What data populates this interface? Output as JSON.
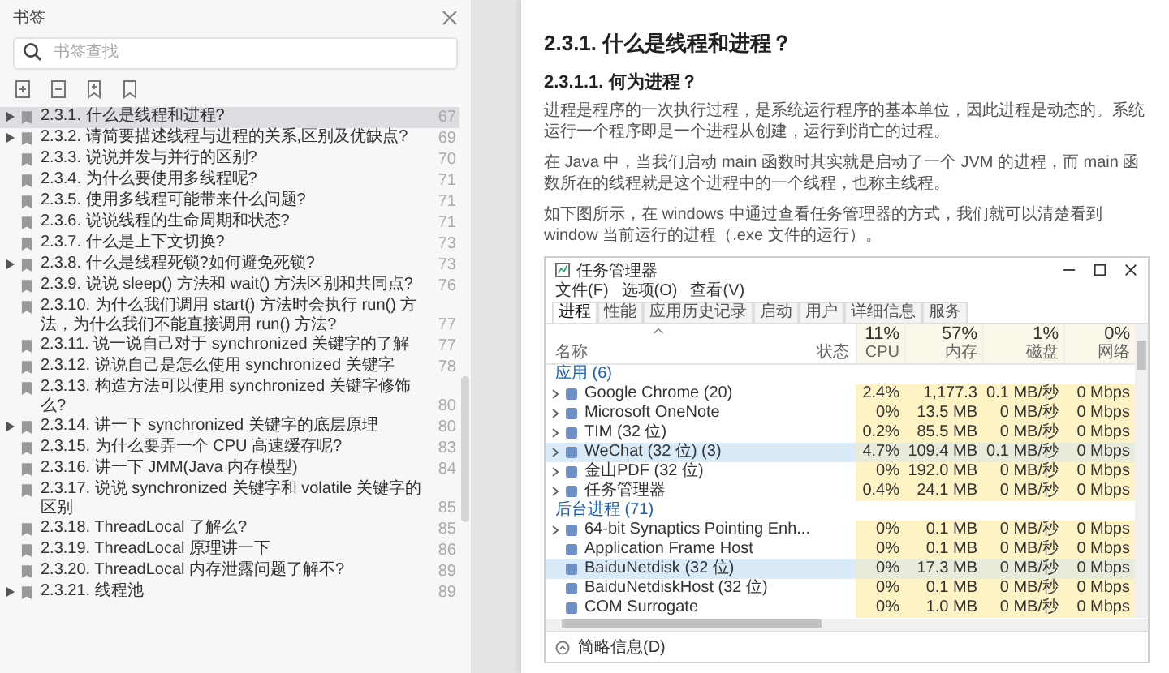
{
  "sidebar": {
    "title": "书签",
    "search": {
      "placeholder": "书签查找"
    },
    "bookmarks": [
      {
        "label": "2.3.1. 什么是线程和进程?",
        "page": "67",
        "has_children": true,
        "selected": true
      },
      {
        "label": "2.3.2. 请简要描述线程与进程的关系,区别及优缺点?",
        "page": "69",
        "has_children": true,
        "selected": false
      },
      {
        "label": "2.3.3. 说说并发与并行的区别?",
        "page": "70",
        "has_children": false,
        "selected": false
      },
      {
        "label": "2.3.4. 为什么要使用多线程呢?",
        "page": "71",
        "has_children": false,
        "selected": false
      },
      {
        "label": "2.3.5. 使用多线程可能带来什么问题?",
        "page": "71",
        "has_children": false,
        "selected": false
      },
      {
        "label": "2.3.6. 说说线程的生命周期和状态?",
        "page": "71",
        "has_children": false,
        "selected": false
      },
      {
        "label": "2.3.7. 什么是上下文切换?",
        "page": "73",
        "has_children": false,
        "selected": false
      },
      {
        "label": "2.3.8. 什么是线程死锁?如何避免死锁?",
        "page": "73",
        "has_children": true,
        "selected": false
      },
      {
        "label": "2.3.9. 说说 sleep() 方法和 wait() 方法区别和共同点?",
        "page": "76",
        "has_children": false,
        "selected": false
      },
      {
        "label": "2.3.10. 为什么我们调用 start() 方法时会执行 run() 方法，为什么我们不能直接调用 run() 方法?",
        "page": "77",
        "has_children": false,
        "selected": false
      },
      {
        "label": "2.3.11. 说一说自己对于 synchronized 关键字的了解",
        "page": "77",
        "has_children": false,
        "selected": false
      },
      {
        "label": "2.3.12. 说说自己是怎么使用 synchronized 关键字",
        "page": "78",
        "has_children": false,
        "selected": false
      },
      {
        "label": "2.3.13. 构造方法可以使用 synchronized 关键字修饰么?",
        "page": "80",
        "has_children": false,
        "selected": false
      },
      {
        "label": "2.3.14. 讲一下 synchronized 关键字的底层原理",
        "page": "80",
        "has_children": true,
        "selected": false
      },
      {
        "label": "2.3.15. 为什么要弄一个 CPU 高速缓存呢?",
        "page": "83",
        "has_children": false,
        "selected": false
      },
      {
        "label": "2.3.16. 讲一下 JMM(Java 内存模型)",
        "page": "84",
        "has_children": false,
        "selected": false
      },
      {
        "label": "2.3.17. 说说 synchronized 关键字和 volatile 关键字的区别",
        "page": "85",
        "has_children": false,
        "selected": false
      },
      {
        "label": "2.3.18. ThreadLocal 了解么?",
        "page": "85",
        "has_children": false,
        "selected": false
      },
      {
        "label": "2.3.19. ThreadLocal 原理讲一下",
        "page": "86",
        "has_children": false,
        "selected": false
      },
      {
        "label": "2.3.20. ThreadLocal 内存泄露问题了解不?",
        "page": "89",
        "has_children": false,
        "selected": false
      },
      {
        "label": "2.3.21. 线程池",
        "page": "89",
        "has_children": true,
        "selected": false
      }
    ]
  },
  "document": {
    "heading": "2.3.1. 什么是线程和进程？",
    "subheading": "2.3.1.1. 何为进程？",
    "paragraphs": [
      "进程是程序的一次执行过程，是系统运行程序的基本单位，因此进程是动态的。系统运行一个程序即是一个进程从创建，运行到消亡的过程。",
      "在 Java 中，当我们启动 main 函数时其实就是启动了一个 JVM 的进程，而 main 函数所在的线程就是这个进程中的一个线程，也称主线程。",
      "如下图所示，在 windows 中通过查看任务管理器的方式，我们就可以清楚看到 window 当前运行的进程（.exe 文件的运行）。"
    ],
    "task_manager": {
      "title": "任务管理器",
      "menu": [
        "文件(F)",
        "选项(O)",
        "查看(V)"
      ],
      "tabs": [
        {
          "label": "进程",
          "selected": true
        },
        {
          "label": "性能",
          "selected": false
        },
        {
          "label": "应用历史记录",
          "selected": false
        },
        {
          "label": "启动",
          "selected": false
        },
        {
          "label": "用户",
          "selected": false
        },
        {
          "label": "详细信息",
          "selected": false
        },
        {
          "label": "服务",
          "selected": false
        }
      ],
      "columns": [
        {
          "label": "名称"
        },
        {
          "label": "状态"
        },
        {
          "percent": "11%",
          "label": "CPU"
        },
        {
          "percent": "57%",
          "label": "内存"
        },
        {
          "percent": "1%",
          "label": "磁盘"
        },
        {
          "percent": "0%",
          "label": "网络"
        }
      ],
      "groups": [
        {
          "label": "应用 (6)",
          "rows": [
            {
              "name": "Google Chrome (20)",
              "cpu": "2.4%",
              "memory": "1,177.3",
              "disk": "0.1 MB/秒",
              "network": "0 Mbps",
              "expandable": true,
              "selected": false
            },
            {
              "name": "Microsoft OneNote",
              "cpu": "0%",
              "memory": "13.5 MB",
              "disk": "0 MB/秒",
              "network": "0 Mbps",
              "expandable": true,
              "selected": false
            },
            {
              "name": "TIM (32 位)",
              "cpu": "0.2%",
              "memory": "85.5 MB",
              "disk": "0 MB/秒",
              "network": "0 Mbps",
              "expandable": true,
              "selected": false
            },
            {
              "name": "WeChat (32 位) (3)",
              "cpu": "4.7%",
              "memory": "109.4 MB",
              "disk": "0.1 MB/秒",
              "network": "0 Mbps",
              "expandable": true,
              "selected": true
            },
            {
              "name": "金山PDF (32 位)",
              "cpu": "0%",
              "memory": "192.0 MB",
              "disk": "0 MB/秒",
              "network": "0 Mbps",
              "expandable": true,
              "selected": false
            },
            {
              "name": "任务管理器",
              "cpu": "0.4%",
              "memory": "24.1 MB",
              "disk": "0 MB/秒",
              "network": "0 Mbps",
              "expandable": true,
              "selected": false
            }
          ]
        },
        {
          "label": "后台进程 (71)",
          "rows": [
            {
              "name": "64-bit Synaptics Pointing Enh...",
              "cpu": "0%",
              "memory": "0.1 MB",
              "disk": "0 MB/秒",
              "network": "0 Mbps",
              "expandable": true,
              "selected": false
            },
            {
              "name": "Application Frame Host",
              "cpu": "0%",
              "memory": "0.1 MB",
              "disk": "0 MB/秒",
              "network": "0 Mbps",
              "expandable": false,
              "selected": false
            },
            {
              "name": "BaiduNetdisk (32 位)",
              "cpu": "0%",
              "memory": "17.3 MB",
              "disk": "0 MB/秒",
              "network": "0 Mbps",
              "expandable": false,
              "selected": true
            },
            {
              "name": "BaiduNetdiskHost (32 位)",
              "cpu": "0%",
              "memory": "0.1 MB",
              "disk": "0 MB/秒",
              "network": "0 Mbps",
              "expandable": false,
              "selected": false
            },
            {
              "name": "COM Surrogate",
              "cpu": "0%",
              "memory": "1.0 MB",
              "disk": "0 MB/秒",
              "network": "0 Mbps",
              "expandable": false,
              "selected": false
            }
          ]
        }
      ],
      "footer": "简略信息(D)"
    }
  }
}
